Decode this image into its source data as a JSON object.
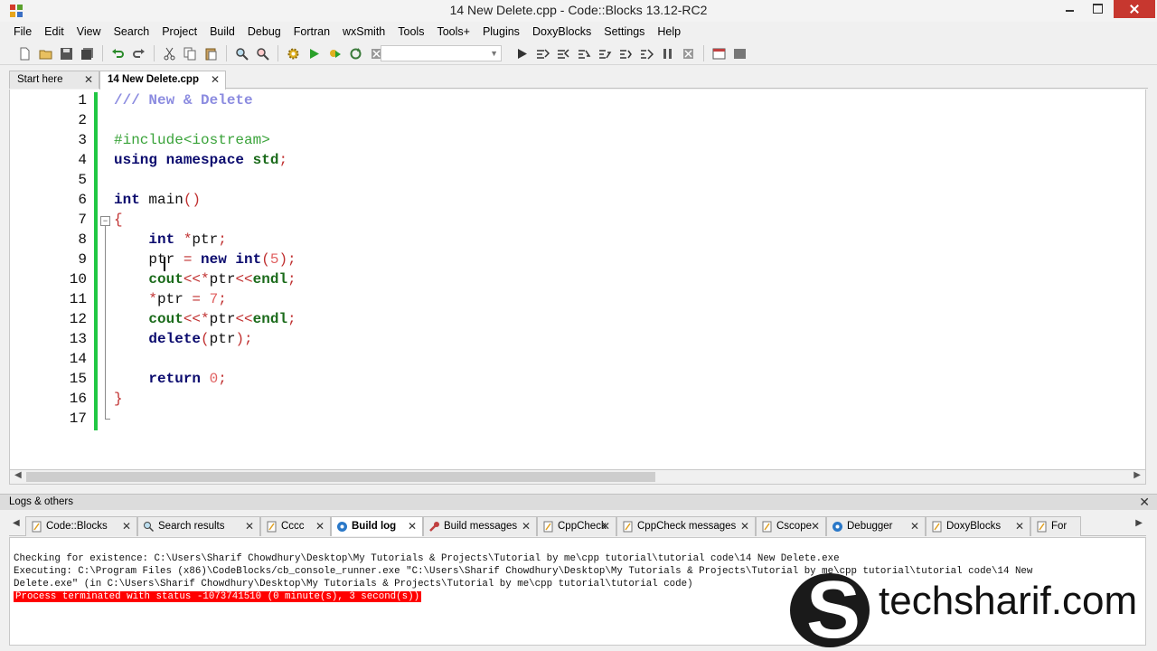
{
  "window": {
    "title": "14 New Delete.cpp - Code::Blocks 13.12-RC2"
  },
  "menu": {
    "items": [
      "File",
      "Edit",
      "View",
      "Search",
      "Project",
      "Build",
      "Debug",
      "Fortran",
      "wxSmith",
      "Tools",
      "Tools+",
      "Plugins",
      "DoxyBlocks",
      "Settings",
      "Help"
    ]
  },
  "toolbar": {
    "build_target_value": ""
  },
  "editor_tabs": [
    {
      "label": "Start here",
      "active": false
    },
    {
      "label": "14 New Delete.cpp",
      "active": true
    }
  ],
  "editor": {
    "line_numbers": [
      "1",
      "2",
      "3",
      "4",
      "5",
      "6",
      "7",
      "8",
      "9",
      "10",
      "11",
      "12",
      "13",
      "14",
      "15",
      "16",
      "17"
    ],
    "lines": [
      [
        {
          "t": "/// New & Delete",
          "c": "comment"
        }
      ],
      [],
      [
        {
          "t": "#include<iostream>",
          "c": "pre"
        }
      ],
      [
        {
          "t": "using ",
          "c": "kw"
        },
        {
          "t": "namespace ",
          "c": "kw"
        },
        {
          "t": "std",
          "c": "std"
        },
        {
          "t": ";",
          "c": "punct"
        }
      ],
      [],
      [
        {
          "t": "int ",
          "c": "kw"
        },
        {
          "t": "main",
          "c": "id"
        },
        {
          "t": "()",
          "c": "punct"
        }
      ],
      [
        {
          "t": "{",
          "c": "punct"
        }
      ],
      [
        {
          "t": "    "
        },
        {
          "t": "int ",
          "c": "kw"
        },
        {
          "t": "*",
          "c": "punct"
        },
        {
          "t": "ptr",
          "c": "id"
        },
        {
          "t": ";",
          "c": "punct"
        }
      ],
      [
        {
          "t": "    "
        },
        {
          "t": "ptr ",
          "c": "id"
        },
        {
          "t": "= ",
          "c": "punct"
        },
        {
          "t": "new ",
          "c": "kw"
        },
        {
          "t": "int",
          "c": "kw"
        },
        {
          "t": "(",
          "c": "punct"
        },
        {
          "t": "5",
          "c": "num"
        },
        {
          "t": ");",
          "c": "punct"
        }
      ],
      [
        {
          "t": "    "
        },
        {
          "t": "cout",
          "c": "std"
        },
        {
          "t": "<<*",
          "c": "punct"
        },
        {
          "t": "ptr",
          "c": "id"
        },
        {
          "t": "<<",
          "c": "punct"
        },
        {
          "t": "endl",
          "c": "std"
        },
        {
          "t": ";",
          "c": "punct"
        }
      ],
      [
        {
          "t": "    "
        },
        {
          "t": "*",
          "c": "punct"
        },
        {
          "t": "ptr ",
          "c": "id"
        },
        {
          "t": "= ",
          "c": "punct"
        },
        {
          "t": "7",
          "c": "num"
        },
        {
          "t": ";",
          "c": "punct"
        }
      ],
      [
        {
          "t": "    "
        },
        {
          "t": "cout",
          "c": "std"
        },
        {
          "t": "<<*",
          "c": "punct"
        },
        {
          "t": "ptr",
          "c": "id"
        },
        {
          "t": "<<",
          "c": "punct"
        },
        {
          "t": "endl",
          "c": "std"
        },
        {
          "t": ";",
          "c": "punct"
        }
      ],
      [
        {
          "t": "    "
        },
        {
          "t": "delete",
          "c": "kw"
        },
        {
          "t": "(",
          "c": "punct"
        },
        {
          "t": "ptr",
          "c": "id"
        },
        {
          "t": ");",
          "c": "punct"
        }
      ],
      [],
      [
        {
          "t": "    "
        },
        {
          "t": "return ",
          "c": "kw"
        },
        {
          "t": "0",
          "c": "num"
        },
        {
          "t": ";",
          "c": "punct"
        }
      ],
      [
        {
          "t": "}",
          "c": "punct"
        }
      ],
      []
    ]
  },
  "logs": {
    "title": "Logs & others",
    "tabs": [
      {
        "label": "Code::Blocks",
        "icon": "document-icon",
        "active": false
      },
      {
        "label": "Search results",
        "icon": "search-icon",
        "active": false
      },
      {
        "label": "Cccc",
        "icon": "document-icon",
        "active": false
      },
      {
        "label": "Build log",
        "icon": "gear-icon",
        "active": true
      },
      {
        "label": "Build messages",
        "icon": "wrench-icon",
        "active": false
      },
      {
        "label": "CppCheck",
        "icon": "document-icon",
        "active": false
      },
      {
        "label": "CppCheck messages",
        "icon": "document-icon",
        "active": false
      },
      {
        "label": "Cscope",
        "icon": "document-icon",
        "active": false
      },
      {
        "label": "Debugger",
        "icon": "gear-icon",
        "active": false
      },
      {
        "label": "DoxyBlocks",
        "icon": "document-icon",
        "active": false
      },
      {
        "label": "For",
        "icon": "document-icon",
        "active": false
      }
    ],
    "lines": [
      "Checking for existence: C:\\Users\\Sharif Chowdhury\\Desktop\\My Tutorials & Projects\\Tutorial by me\\cpp tutorial\\tutorial code\\14 New Delete.exe",
      "Executing: C:\\Program Files (x86)\\CodeBlocks/cb_console_runner.exe \"C:\\Users\\Sharif Chowdhury\\Desktop\\My Tutorials & Projects\\Tutorial by me\\cpp tutorial\\tutorial code\\14 New",
      "Delete.exe\" (in C:\\Users\\Sharif Chowdhury\\Desktop\\My Tutorials & Projects\\Tutorial by me\\cpp tutorial\\tutorial code)"
    ],
    "error_line": "Process terminated with status -1073741510 (0 minute(s), 3 second(s))"
  },
  "watermark": {
    "text": "techsharif.com",
    "logo_letter": "S"
  },
  "colors": {
    "change_bar": "#21c744",
    "error_bg": "#ff0000",
    "close_button": "#c7372f"
  }
}
